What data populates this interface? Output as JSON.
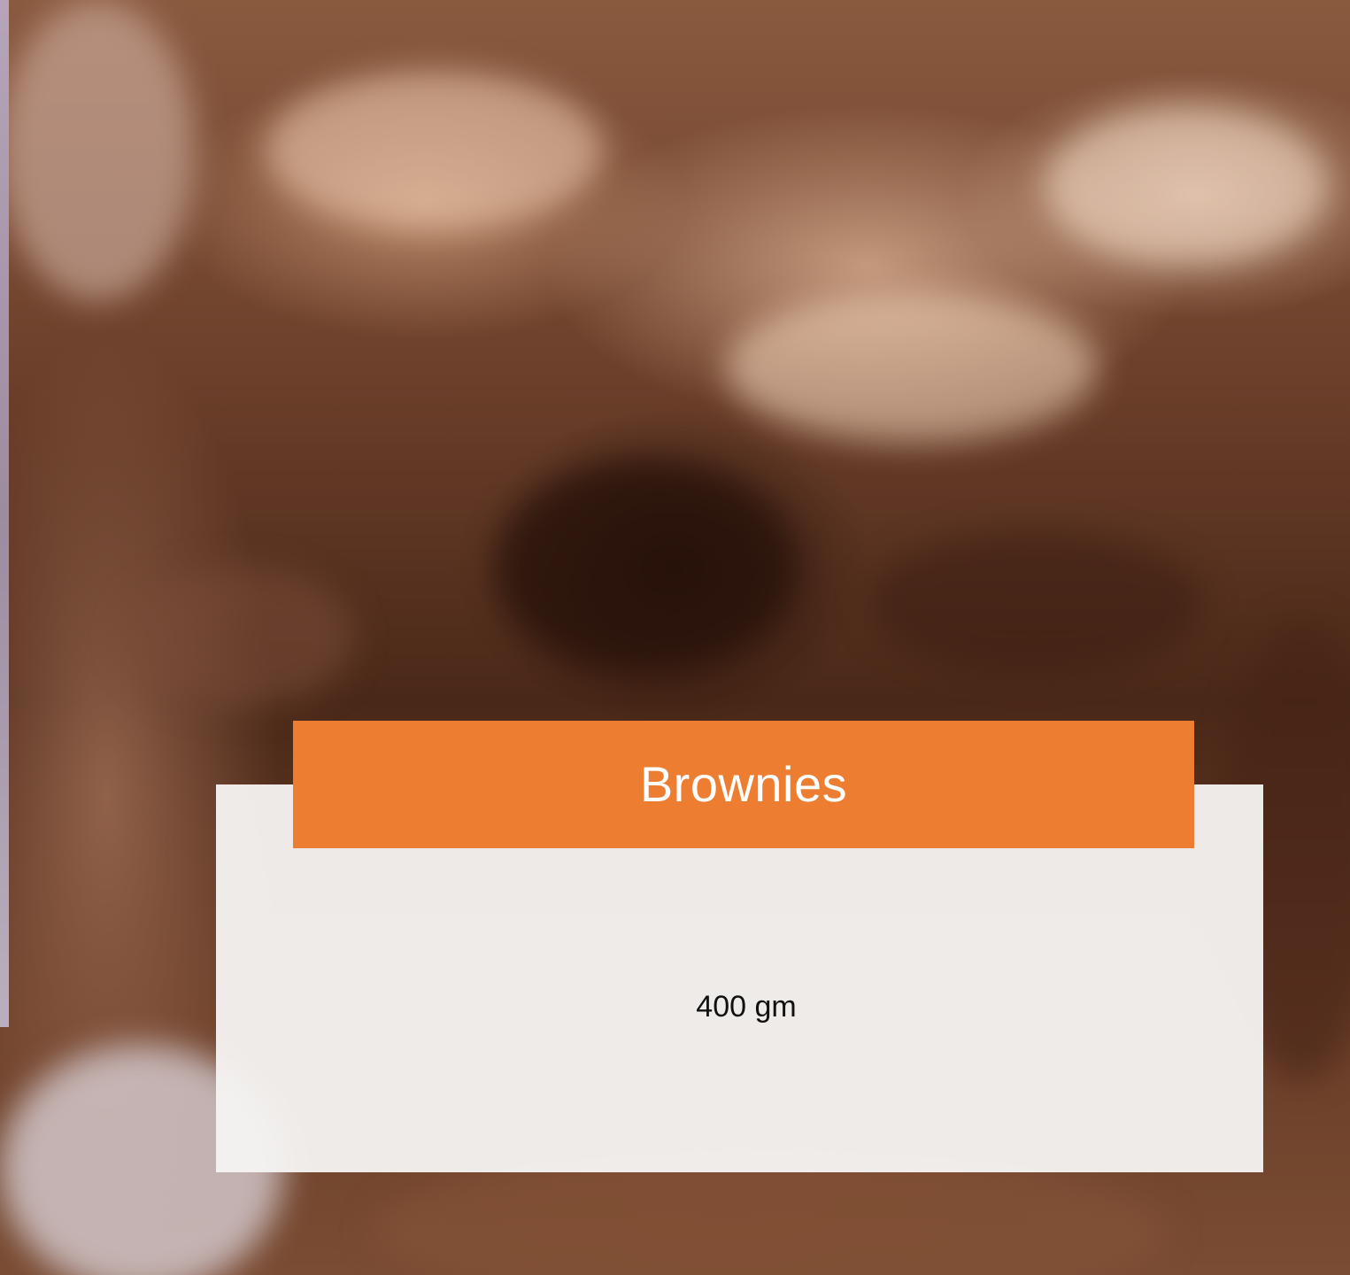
{
  "product": {
    "title": "Brownies",
    "weight": "400 gm"
  },
  "colors": {
    "title_bar": "#ed7d31",
    "title_text": "#ffffff",
    "panel": "#f6f4f3",
    "body_text": "#111111"
  }
}
